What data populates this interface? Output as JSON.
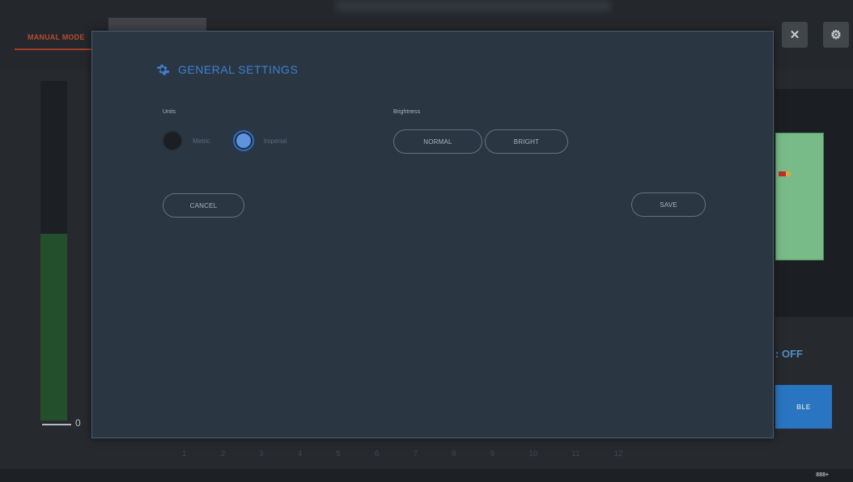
{
  "background": {
    "manual_tab_label": "MANUAL MODE",
    "level_value": "0",
    "level_fill_fraction": 0.55,
    "right_state_text": ": OFF",
    "right_button_label": "BLE",
    "icons": [
      "tools-icon",
      "gear-icon"
    ],
    "ruler_ticks": [
      "1",
      "2",
      "3",
      "4",
      "5",
      "6",
      "7",
      "8",
      "9",
      "10",
      "11",
      "12"
    ],
    "footer_items": [
      "",
      ""
    ],
    "footer_right_value": "888+"
  },
  "modal": {
    "title": "GENERAL SETTINGS",
    "title_icon": "gear-icon",
    "units": {
      "label": "Units",
      "options": [
        {
          "label": "Metric",
          "selected": false
        },
        {
          "label": "Imperial",
          "selected": true
        }
      ]
    },
    "brightness": {
      "label": "Brightness",
      "options": [
        "NORMAL",
        "BRIGHT"
      ]
    },
    "cancel_label": "CANCEL",
    "save_label": "SAVE"
  },
  "colors": {
    "accent_blue": "#3f7fd0",
    "alert_red": "#c0462b",
    "modal_bg": "#2b3643"
  }
}
